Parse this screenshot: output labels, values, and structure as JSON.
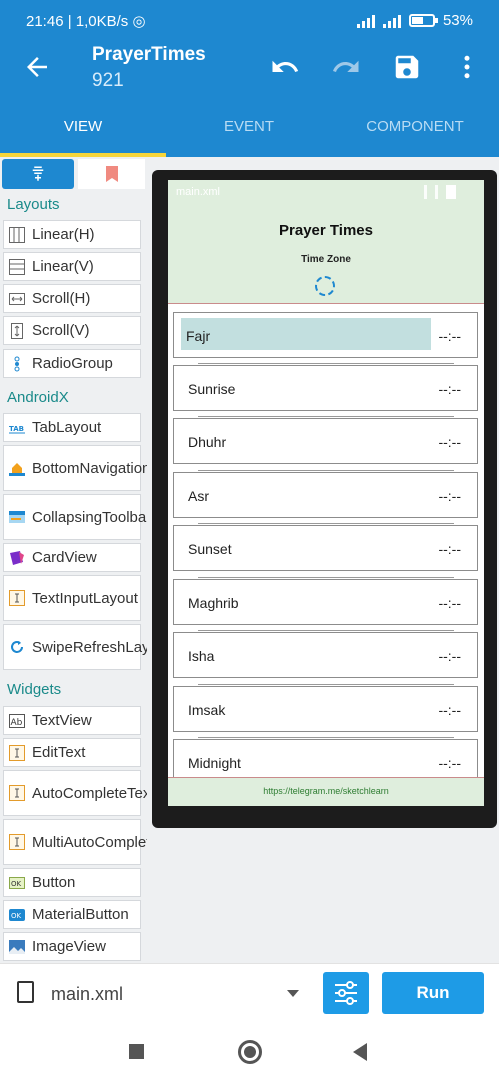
{
  "status_bar": {
    "time": "21:46",
    "net_speed": "1,0KB/s",
    "battery": "53%"
  },
  "app_bar": {
    "title": "PrayerTimes",
    "subtitle": "921"
  },
  "tabs": [
    {
      "label": "VIEW",
      "active": true
    },
    {
      "label": "EVENT",
      "active": false
    },
    {
      "label": "COMPONENT",
      "active": false
    }
  ],
  "palette": {
    "sections": {
      "layouts": "Layouts",
      "androidx": "AndroidX",
      "widgets": "Widgets"
    },
    "items": [
      {
        "label": "Linear(H)",
        "icon": "linear-h-icon"
      },
      {
        "label": "Linear(V)",
        "icon": "linear-v-icon"
      },
      {
        "label": "Scroll(H)",
        "icon": "scroll-h-icon"
      },
      {
        "label": "Scroll(V)",
        "icon": "scroll-v-icon"
      },
      {
        "label": "RadioGroup",
        "icon": "radiogroup-icon"
      },
      {
        "label": "TabLayout",
        "icon": "tablayout-icon"
      },
      {
        "label": "BottomNavigationView",
        "icon": "bottomnav-icon"
      },
      {
        "label": "CollapsingToolbar",
        "icon": "collapsing-toolbar-icon"
      },
      {
        "label": "CardView",
        "icon": "cardview-icon"
      },
      {
        "label": "TextInputLayout",
        "icon": "textinput-icon"
      },
      {
        "label": "SwipeRefreshLayout",
        "icon": "swiperefresh-icon"
      },
      {
        "label": "TextView",
        "icon": "textview-icon"
      },
      {
        "label": "EditText",
        "icon": "edittext-icon"
      },
      {
        "label": "AutoCompleteTextView",
        "icon": "autocomplete-icon"
      },
      {
        "label": "MultiAutoCompleteTextView",
        "icon": "multiautocomplete-icon"
      },
      {
        "label": "Button",
        "icon": "button-icon"
      },
      {
        "label": "MaterialButton",
        "icon": "materialbutton-icon"
      },
      {
        "label": "ImageView",
        "icon": "imageview-icon"
      }
    ]
  },
  "preview": {
    "status_text": "main.xml",
    "title": "Prayer Times",
    "time_zone_label": "Time Zone",
    "rows": [
      {
        "name": "Fajr",
        "time": "--:--"
      },
      {
        "name": "Sunrise",
        "time": "--:--"
      },
      {
        "name": "Dhuhr",
        "time": "--:--"
      },
      {
        "name": "Asr",
        "time": "--:--"
      },
      {
        "name": "Sunset",
        "time": "--:--"
      },
      {
        "name": "Maghrib",
        "time": "--:--"
      },
      {
        "name": "Isha",
        "time": "--:--"
      },
      {
        "name": "Imsak",
        "time": "--:--"
      },
      {
        "name": "Midnight",
        "time": "--:--"
      }
    ],
    "footer_link": "https://telegram.me/sketchlearn"
  },
  "bottom_bar": {
    "file_name": "main.xml",
    "run_label": "Run"
  },
  "colors": {
    "primary": "#1e88d0",
    "accent": "#f7d53a",
    "run": "#1e9be6",
    "section": "#1a8a8a"
  }
}
